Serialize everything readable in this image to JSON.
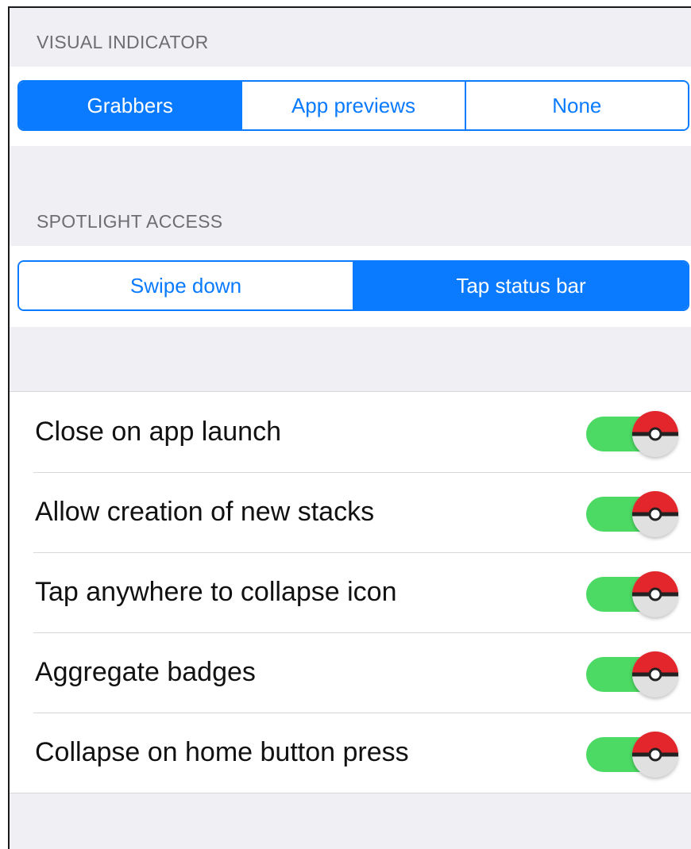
{
  "visual_indicator": {
    "header": "VISUAL INDICATOR",
    "options": [
      {
        "label": "Grabbers",
        "selected": true
      },
      {
        "label": "App previews",
        "selected": false
      },
      {
        "label": "None",
        "selected": false
      }
    ]
  },
  "spotlight_access": {
    "header": "SPOTLIGHT ACCESS",
    "options": [
      {
        "label": "Swipe down",
        "selected": false
      },
      {
        "label": "Tap status bar",
        "selected": true
      }
    ]
  },
  "settings": [
    {
      "label": "Close on app launch",
      "on": true
    },
    {
      "label": "Allow creation of new stacks",
      "on": true
    },
    {
      "label": "Tap anywhere to collapse icon",
      "on": true
    },
    {
      "label": "Aggregate badges",
      "on": true
    },
    {
      "label": "Collapse on home button press",
      "on": true
    }
  ],
  "colors": {
    "accent": "#0a7aff",
    "toggle_on": "#4cd964",
    "toggle_knob": "pokeball-red-white"
  }
}
